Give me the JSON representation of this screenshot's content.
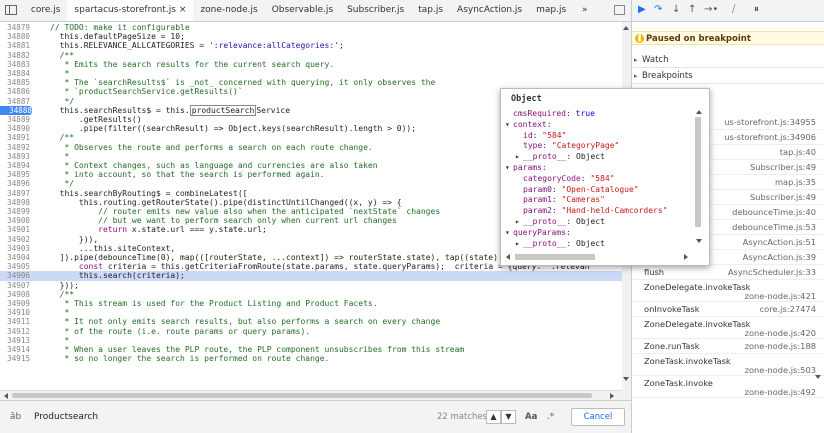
{
  "tabs": [
    {
      "label": "core.js",
      "active": false
    },
    {
      "label": "spartacus-storefront.js",
      "active": true
    },
    {
      "label": "zone-node.js",
      "active": false
    },
    {
      "label": "Observable.js",
      "active": false
    },
    {
      "label": "Subscriber.js",
      "active": false
    },
    {
      "label": "tap.js",
      "active": false
    },
    {
      "label": "AsyncAction.js",
      "active": false
    },
    {
      "label": "map.js",
      "active": false
    }
  ],
  "tab_close_glyph": "×",
  "tab_more_glyph": "»",
  "editor": {
    "lines": [
      {
        "n": "34879",
        "html": "<span class='cm'>// TODO: make it configurable</span>"
      },
      {
        "n": "34880",
        "html": "  this.defaultPageSize = <span class='vn'>10</span>;"
      },
      {
        "n": "34881",
        "html": "  this.RELEVANCE_ALLCATEGORIES = <span class='str'>':relevance:allCategories:'</span>;"
      },
      {
        "n": "34882",
        "html": "  <span class='cm'>/**</span>"
      },
      {
        "n": "34883",
        "html": "<span class='cm'>   * Emits the search results for the current search query.</span>"
      },
      {
        "n": "34884",
        "html": "<span class='cm'>   *</span>"
      },
      {
        "n": "34885",
        "html": "<span class='cm'>   * The `searchResults$` is _not_ concerned with querying, it only observes the</span>"
      },
      {
        "n": "34886",
        "html": "<span class='cm'>   * `productSearchService.getResults()`</span>"
      },
      {
        "n": "34887",
        "html": "<span class='cm'>   */</span>"
      },
      {
        "n": "34888",
        "html": "  this.searchResults$ = this.<span class='hl-box'>productSearch</span>Service",
        "bp": true
      },
      {
        "n": "34889",
        "html": "      .getResults()"
      },
      {
        "n": "34890",
        "html": "      .pipe(filter((searchResult) => Object.keys(searchResult).length > <span class='vn'>0</span>));"
      },
      {
        "n": "34891",
        "html": "  <span class='cm'>/**</span>"
      },
      {
        "n": "34892",
        "html": "<span class='cm'>   * Observes the route and performs a search on each route change.</span>"
      },
      {
        "n": "34893",
        "html": "<span class='cm'>   *</span>"
      },
      {
        "n": "34894",
        "html": "<span class='cm'>   * Context changes, such as language and currencies are also taken</span>"
      },
      {
        "n": "34895",
        "html": "<span class='cm'>   * into account, so that the search is performed again.</span>"
      },
      {
        "n": "34896",
        "html": "<span class='cm'>   */</span>"
      },
      {
        "n": "34897",
        "html": "  this.searchByRouting$ = combineLatest(["
      },
      {
        "n": "34898",
        "html": "      this.routing.getRouterState().pipe(distinctUntilChanged((x, y) => {"
      },
      {
        "n": "34899",
        "html": "<span class='cm'>          // router emits new value also when the anticipated `nextState` changes</span>"
      },
      {
        "n": "34900",
        "html": "<span class='cm'>          // but we want to perform search only when current url changes</span>"
      },
      {
        "n": "34901",
        "html": "          <span class='kw'>return</span> x.state.url === y.state.url;"
      },
      {
        "n": "34902",
        "html": "      })),"
      },
      {
        "n": "34903",
        "html": "      ...this.siteContext,"
      },
      {
        "n": "34904",
        "html": "  ]).pipe(debounceTime(<span class='vn'>0</span>), map(([routerState, ...context]) => routerState.state), tap((state) => {  state = {ur"
      },
      {
        "n": "34905",
        "html": "      <span class='kw'>const</span> criteria = this.getCriteriaFromRoute(state.params, state.queryParams);  criteria = {query: \":relevan"
      },
      {
        "n": "34906",
        "html": "      this.search(criteria);",
        "highlight": true
      },
      {
        "n": "34907",
        "html": "  }));"
      },
      {
        "n": "34908",
        "html": "  <span class='cm'>/**</span>"
      },
      {
        "n": "34909",
        "html": "<span class='cm'>   * This stream is used for the Product Listing and Product Facets.</span>"
      },
      {
        "n": "34910",
        "html": "<span class='cm'>   *</span>"
      },
      {
        "n": "34911",
        "html": "<span class='cm'>   * It not only emits search results, but also performs a search on every change</span>"
      },
      {
        "n": "34912",
        "html": "<span class='cm'>   * of the route (i.e. route params or query params).</span>"
      },
      {
        "n": "34913",
        "html": "<span class='cm'>   *</span>"
      },
      {
        "n": "34914",
        "html": "<span class='cm'>   * When a user leaves the PLP route, the PLP component unsubscribes from this stream</span>"
      },
      {
        "n": "34915",
        "html": "<span class='cm'>   * so no longer the search is performed on route change.</span>"
      }
    ]
  },
  "search": {
    "icon_glyph": "ȁb",
    "query": "Productsearch",
    "match_count": "22 matches",
    "prev_glyph": "▲",
    "next_glyph": "▼",
    "case_label": "Aa",
    "regex_label": ".*",
    "cancel_label": "Cancel"
  },
  "debugger": {
    "paused_text": "Paused on breakpoint",
    "paused_icon_glyph": "❚",
    "watch_label": "Watch",
    "breakpoints_label": "Breakpoints",
    "resume_glyph": "▶",
    "step_over_glyph": "↷",
    "step_into_glyph": "↓",
    "step_out_glyph": "↑",
    "step_glyph": "→•",
    "deactivate_glyph": "⧸",
    "pause_exceptions_glyph": "⏸"
  },
  "callstack": [
    {
      "fn": "",
      "loc": "us-storefront.js:34955"
    },
    {
      "fn": "",
      "loc": "us-storefront.js:34906"
    },
    {
      "fn": "",
      "loc": "tap.js:40"
    },
    {
      "fn": "",
      "loc": "Subscriber.js:49"
    },
    {
      "fn": "",
      "loc": "map.js:35"
    },
    {
      "fn": "",
      "loc": "Subscriber.js:49"
    },
    {
      "fn": "",
      "loc": "debounceTime.js:40"
    },
    {
      "fn": "",
      "loc": "debounceTime.js:53"
    },
    {
      "fn": "",
      "loc": "AsyncAction.js:51"
    },
    {
      "fn": "execute",
      "loc": "AsyncAction.js:39"
    },
    {
      "fn": "flush",
      "loc": "AsyncScheduler.js:33"
    },
    {
      "fn": "ZoneDelegate.invokeTask",
      "loc": "zone-node.js:421"
    },
    {
      "fn": "onInvokeTask",
      "loc": "core.js:27474"
    },
    {
      "fn": "ZoneDelegate.invokeTask",
      "loc": "zone-node.js:420"
    },
    {
      "fn": "Zone.runTask",
      "loc": "zone-node.js:188"
    },
    {
      "fn": "ZoneTask.invokeTask",
      "loc": "zone-node.js:503"
    },
    {
      "fn": "ZoneTask.invoke",
      "loc": "zone-node.js:492"
    }
  ],
  "popover": {
    "title": "Object",
    "rows": [
      {
        "indent": 0,
        "tri": "",
        "key": "cmsRequired",
        "value": "true",
        "vtype": "vk"
      },
      {
        "indent": 0,
        "tri": "▾",
        "key": "context",
        "value": "",
        "vtype": "obj"
      },
      {
        "indent": 1,
        "tri": "",
        "key": "id",
        "value": "\"584\"",
        "vtype": "vs"
      },
      {
        "indent": 1,
        "tri": "",
        "key": "type",
        "value": "\"CategoryPage\"",
        "vtype": "vs"
      },
      {
        "indent": 1,
        "tri": "▸",
        "key": "__proto__",
        "value": "Object",
        "vtype": "obj"
      },
      {
        "indent": 0,
        "tri": "▾",
        "key": "params",
        "value": "",
        "vtype": "obj"
      },
      {
        "indent": 1,
        "tri": "",
        "key": "categoryCode",
        "value": "\"584\"",
        "vtype": "vs"
      },
      {
        "indent": 1,
        "tri": "",
        "key": "param0",
        "value": "\"Open-Catalogue\"",
        "vtype": "vs"
      },
      {
        "indent": 1,
        "tri": "",
        "key": "param1",
        "value": "\"Cameras\"",
        "vtype": "vs"
      },
      {
        "indent": 1,
        "tri": "",
        "key": "param2",
        "value": "\"Hand-held-Camcorders\"",
        "vtype": "vs"
      },
      {
        "indent": 1,
        "tri": "▸",
        "key": "__proto__",
        "value": "Object",
        "vtype": "obj"
      },
      {
        "indent": 0,
        "tri": "▾",
        "key": "queryParams",
        "value": "",
        "vtype": "obj"
      },
      {
        "indent": 1,
        "tri": "▸",
        "key": "__proto__",
        "value": "Object",
        "vtype": "obj"
      }
    ]
  }
}
